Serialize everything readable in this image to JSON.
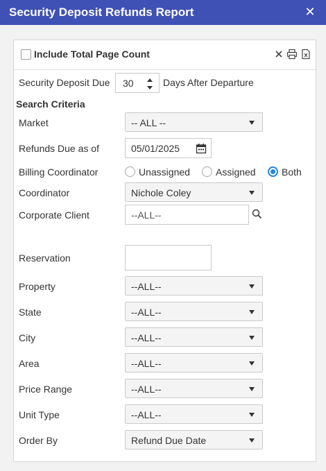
{
  "window": {
    "title": "Security Deposit Refunds Report",
    "close_glyph": "✕"
  },
  "panel": {
    "include_total_label": "Include Total Page Count",
    "include_total_checked": false,
    "icons": [
      "close-icon",
      "print-icon",
      "excel-export-icon"
    ]
  },
  "deposit_due": {
    "label": "Security Deposit Due",
    "value": "30",
    "suffix": "Days After Departure"
  },
  "search_criteria": {
    "heading": "Search Criteria",
    "market": {
      "label": "Market",
      "value": "-- ALL --"
    },
    "refunds_due": {
      "label": "Refunds Due as of",
      "value": "05/01/2025"
    },
    "billing_coordinator": {
      "label": "Billing Coordinator",
      "options": [
        "Unassigned",
        "Assigned",
        "Both"
      ],
      "selected": "Both"
    },
    "coordinator": {
      "label": "Coordinator",
      "value": "Nichole Coley"
    },
    "corporate_client": {
      "label": "Corporate Client",
      "placeholder": "--ALL--"
    },
    "reservation": {
      "label": "Reservation",
      "value": ""
    },
    "property": {
      "label": "Property",
      "value": "--ALL--"
    },
    "state": {
      "label": "State",
      "value": "--ALL--"
    },
    "city": {
      "label": "City",
      "value": "--ALL--"
    },
    "area": {
      "label": "Area",
      "value": "--ALL--"
    },
    "price_range": {
      "label": "Price Range",
      "value": "--ALL--"
    },
    "unit_type": {
      "label": "Unit Type",
      "value": "--ALL--"
    },
    "order_by": {
      "label": "Order By",
      "value": "Refund Due Date"
    }
  },
  "colors": {
    "titlebar": "#3f51b5",
    "radio_accent": "#1e88e5"
  }
}
